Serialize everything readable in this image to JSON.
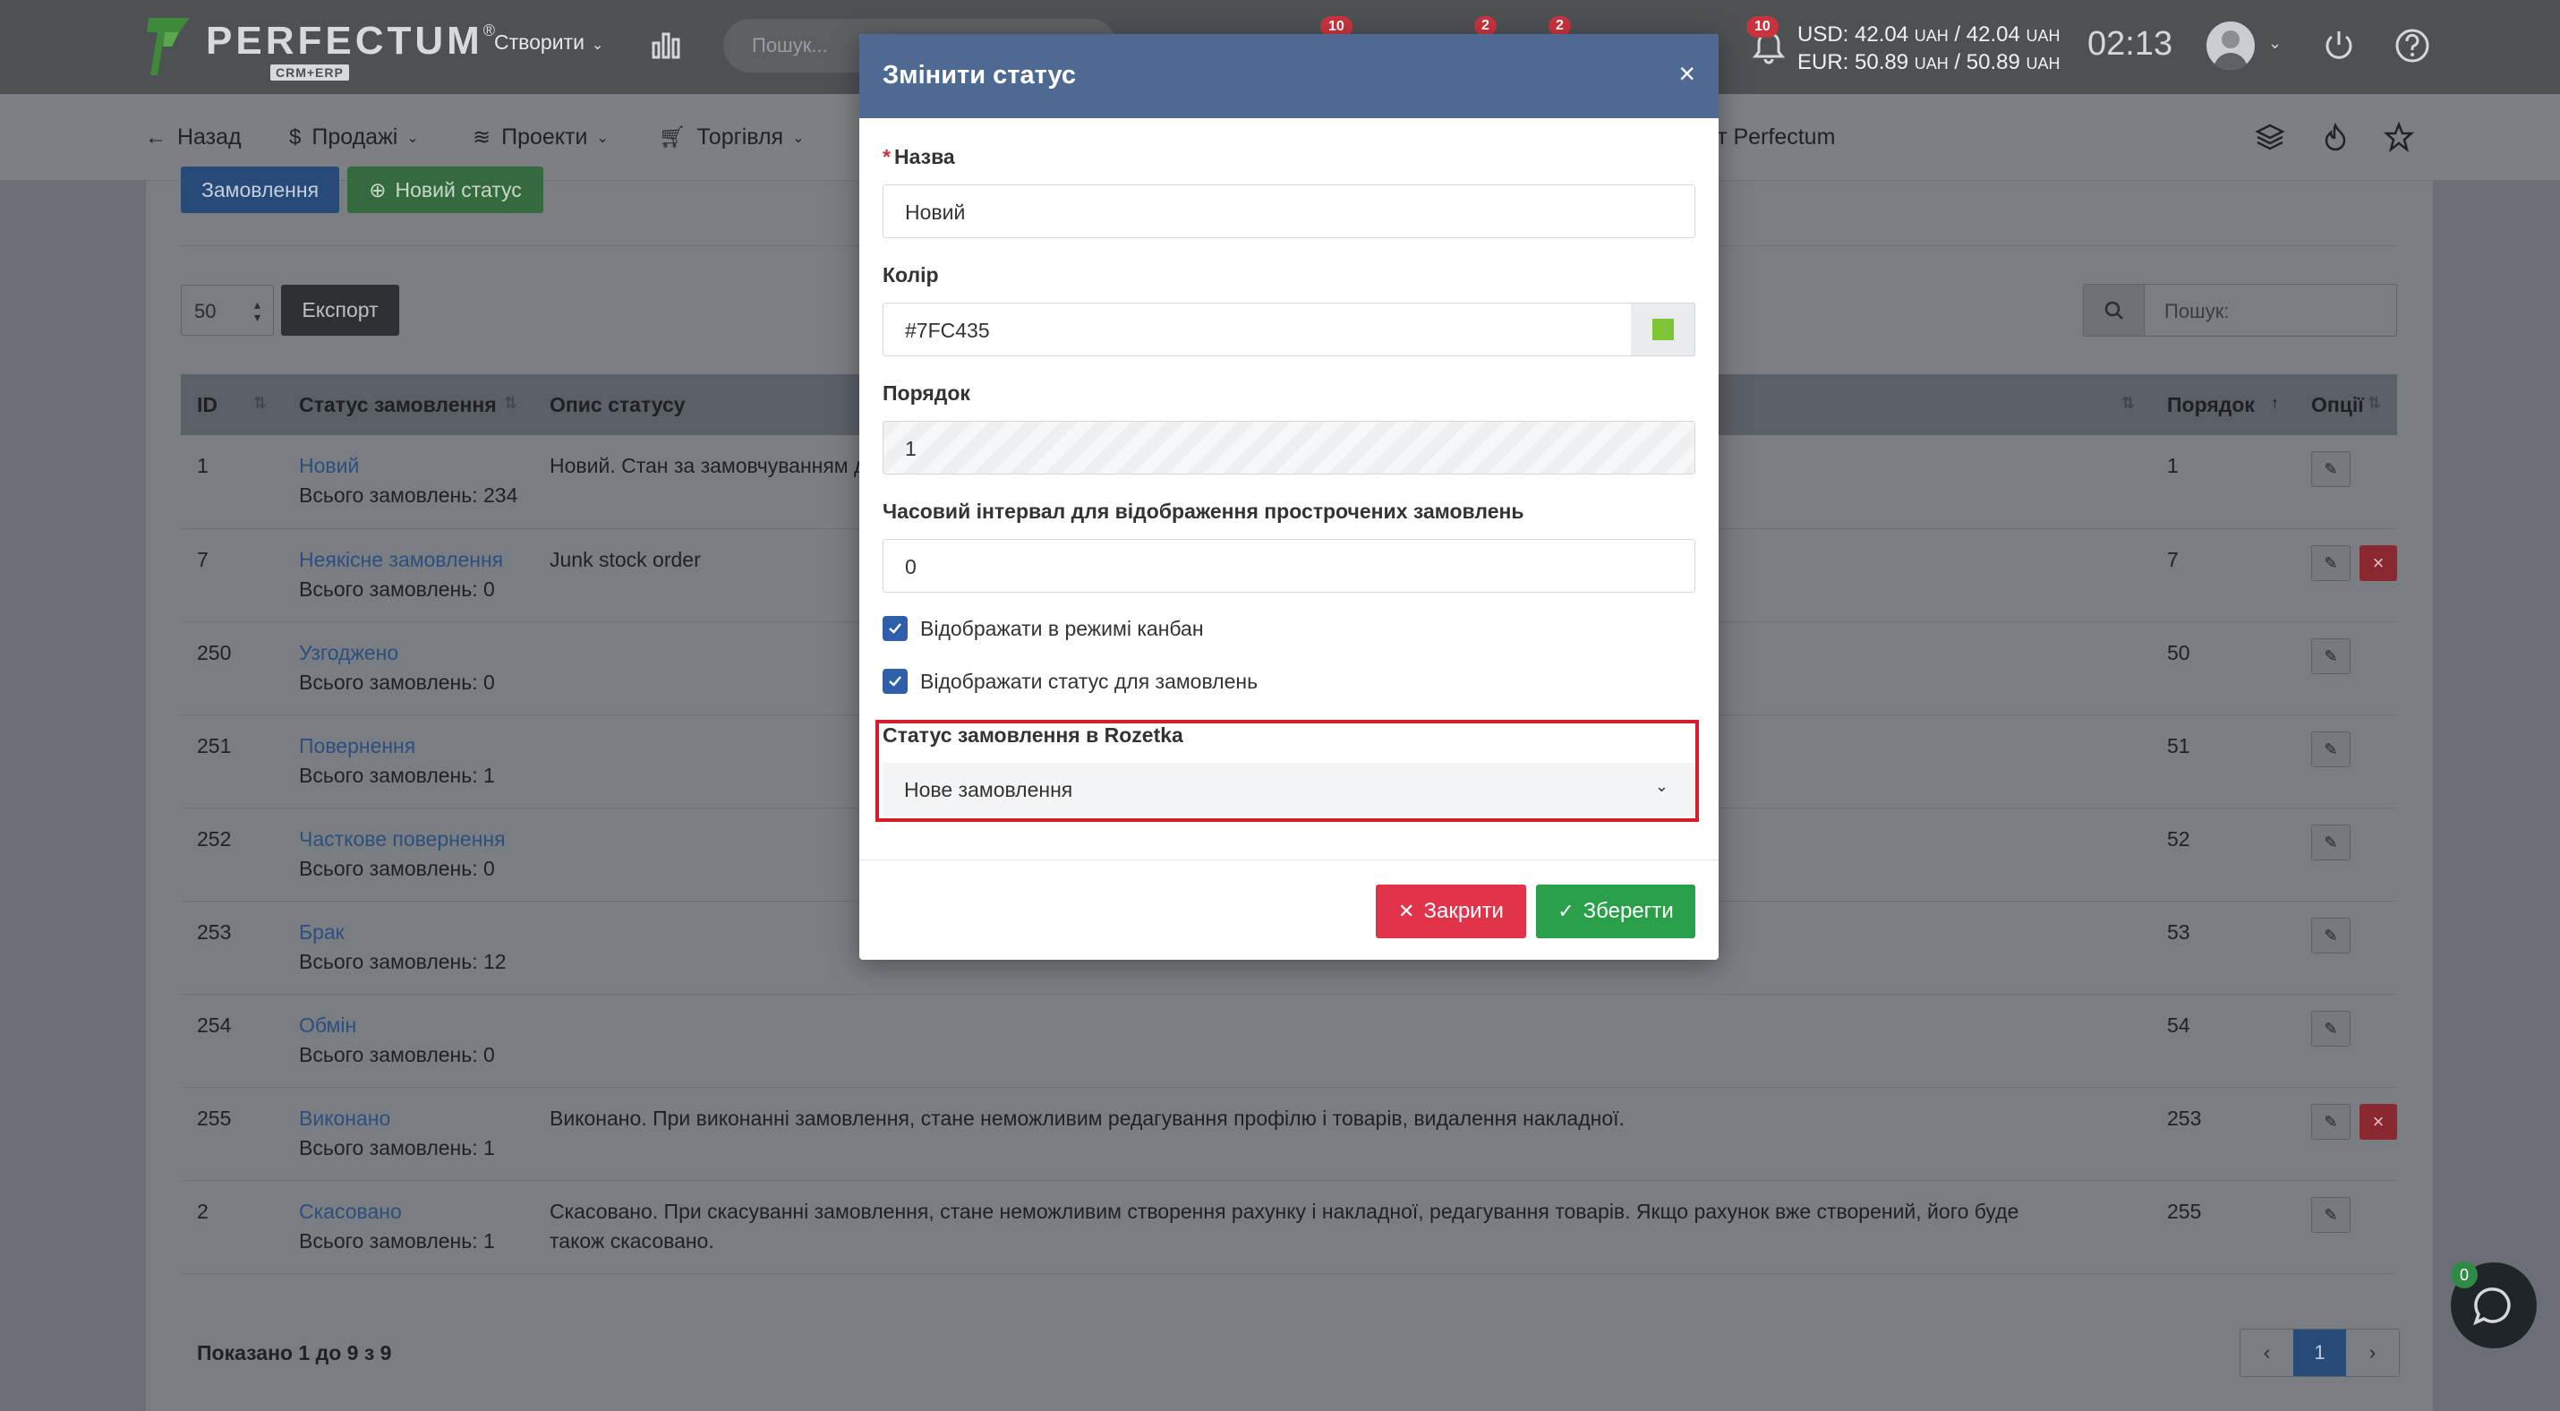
{
  "header": {
    "logo_text": "PERFECTUM",
    "logo_reg": "®",
    "logo_sub": "CRM+ERP",
    "create_label": "Створити",
    "search_placeholder": "Пошук...",
    "badges": {
      "b1": "10",
      "b2": "2",
      "b3": "2",
      "b4": "10"
    },
    "rates": {
      "usd_label": "USD: 42.04",
      "usd_unit1": "UAH",
      "usd_sep": " / 42.04",
      "usd_unit2": "UAH",
      "eur_label": "EUR: 50.89",
      "eur_unit1": "UAH",
      "eur_sep": " / 50.89",
      "eur_unit2": "UAH"
    },
    "time": "02:13"
  },
  "subnav": {
    "back": "Назад",
    "sales": "Продажі",
    "projects": "Проекти",
    "trade": "Торгівля",
    "perfectum": "ет Perfectum"
  },
  "toolbar": {
    "orders_label": "Замовлення",
    "new_status_label": "Новий статус",
    "per_page": "50",
    "export_label": "Експорт",
    "search_placeholder": "Пошук:"
  },
  "table": {
    "headers": {
      "id": "ID",
      "status": "Статус замовлення",
      "desc": "Опис статусу",
      "order": "Порядок",
      "options": "Опції"
    },
    "rows": [
      {
        "id": "1",
        "name": "Новий",
        "count": "Всього замовлень: 234",
        "desc": "Новий. Стан за замовчуванням д",
        "order": "1",
        "deletable": false
      },
      {
        "id": "7",
        "name": "Неякісне замовлення",
        "count": "Всього замовлень: 0",
        "desc": "Junk stock order",
        "order": "7",
        "deletable": true
      },
      {
        "id": "250",
        "name": "Узгоджено",
        "count": "Всього замовлень: 0",
        "desc": "",
        "order": "50",
        "deletable": false
      },
      {
        "id": "251",
        "name": "Повернення",
        "count": "Всього замовлень: 1",
        "desc": "",
        "order": "51",
        "deletable": false
      },
      {
        "id": "252",
        "name": "Часткове повернення",
        "count": "Всього замовлень: 0",
        "desc": "",
        "order": "52",
        "deletable": false
      },
      {
        "id": "253",
        "name": "Брак",
        "count": "Всього замовлень: 12",
        "desc": "",
        "order": "53",
        "deletable": false
      },
      {
        "id": "254",
        "name": "Обмін",
        "count": "Всього замовлень: 0",
        "desc": "",
        "order": "54",
        "deletable": false
      },
      {
        "id": "255",
        "name": "Виконано",
        "count": "Всього замовлень: 1",
        "desc": "Виконано. При виконанні замовлення, стане неможливим редагування профілю і товарів, видалення накладної.",
        "order": "253",
        "deletable": true
      },
      {
        "id": "2",
        "name": "Скасовано",
        "count": "Всього замовлень: 1",
        "desc": "Скасовано. При скасуванні замовлення, стане неможливим створення рахунку і накладної, редагування товарів. Якщо рахунок вже створений, його буде також скасовано.",
        "order": "255",
        "deletable": false
      }
    ]
  },
  "footer": {
    "showing": "Показано 1 до 9 з 9",
    "page": "1",
    "chat_badge": "0"
  },
  "modal": {
    "title": "Змінити статус",
    "close_symbol": "×",
    "name_label": "Назва",
    "name_required_mark": "*",
    "name_value": "Новий",
    "color_label": "Колір",
    "color_value": "#7FC435",
    "order_label": "Порядок",
    "order_value": "1",
    "interval_label": "Часовий інтервал для відображення прострочених замовлень",
    "interval_value": "0",
    "kanban_label": "Відображати в режимі канбан",
    "kanban_checked": true,
    "show_status_label": "Відображати статус для замовлень",
    "show_status_checked": true,
    "rozetka_label": "Статус замовлення в Rozetka",
    "rozetka_value": "Нове замовлення",
    "close_button": "Закрити",
    "save_button": "Зберегти"
  },
  "colors": {
    "modal_header": "#4e6a93",
    "swatch": "#7FC435",
    "close_btn": "#e1344a",
    "save_btn": "#2aa04a",
    "highlight": "#d41c2a",
    "checkbox": "#2f5fa8"
  },
  "icons": [
    "chevron-down-icon",
    "bar-chart-icon",
    "bell-icon",
    "power-icon",
    "help-icon",
    "arrow-left-icon",
    "dollar-icon",
    "layers-icon",
    "cart-icon",
    "fire-icon",
    "star-icon",
    "plus-circle-icon",
    "search-icon",
    "edit-icon",
    "delete-icon",
    "chat-icon",
    "check-icon",
    "close-icon"
  ]
}
